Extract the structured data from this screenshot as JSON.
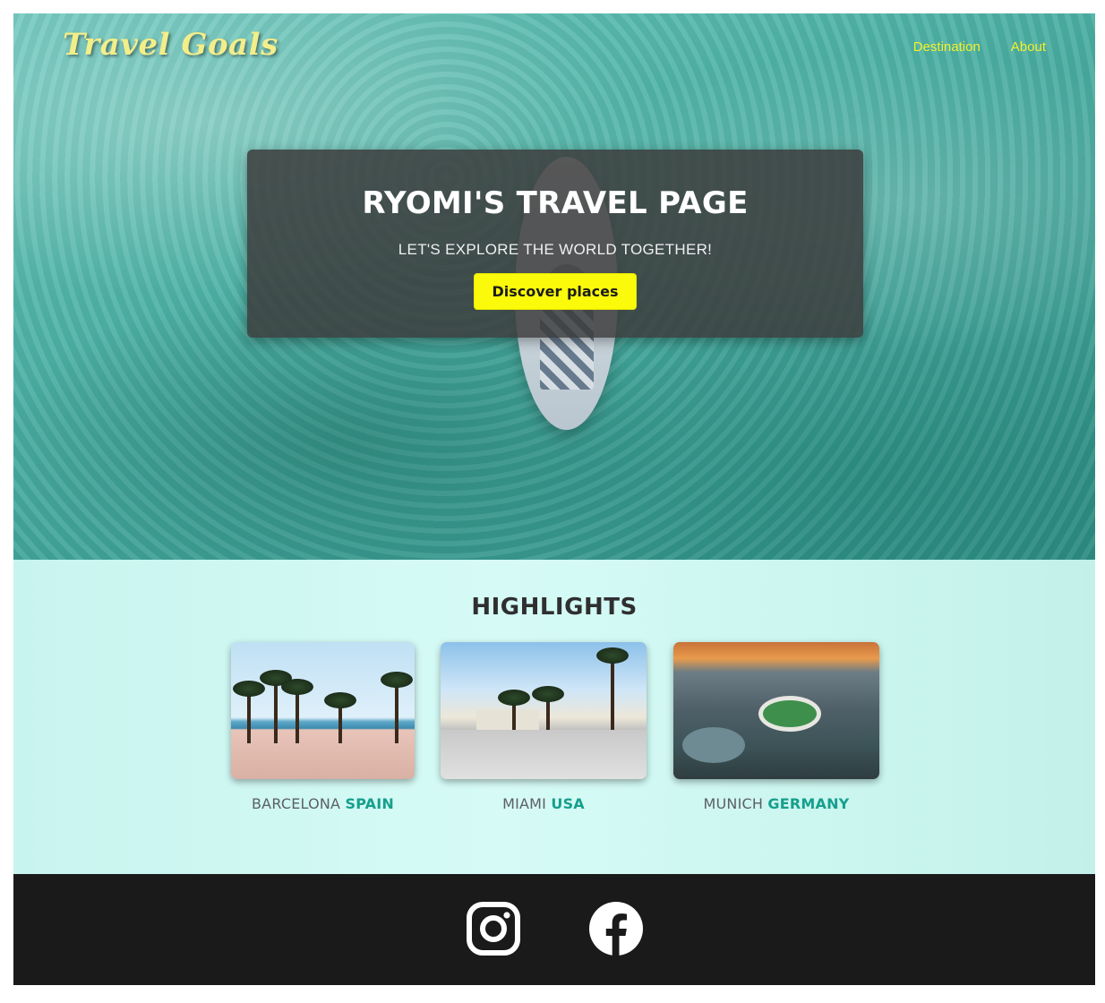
{
  "header": {
    "logo": "Travel Goals",
    "nav": [
      {
        "label": "Destination"
      },
      {
        "label": "About"
      }
    ]
  },
  "hero": {
    "title": "RYOMI'S TRAVEL PAGE",
    "subtitle": "LET'S EXPLORE THE WORLD TOGETHER!",
    "cta_label": "Discover places"
  },
  "highlights": {
    "title": "HIGHLIGHTS",
    "cards": [
      {
        "city": "BARCELONA",
        "country": "SPAIN"
      },
      {
        "city": "MIAMI",
        "country": "USA"
      },
      {
        "city": "MUNICH",
        "country": "GERMANY"
      }
    ]
  },
  "footer": {
    "icons": [
      "instagram-icon",
      "facebook-icon"
    ]
  },
  "colors": {
    "nav_text": "#f4f12a",
    "logo": "#f2ee8a",
    "cta_bg": "#fafa0a",
    "country_accent": "#169f8d",
    "highlights_bg": "#d6fbf6",
    "footer_bg": "#1a1a1b"
  }
}
